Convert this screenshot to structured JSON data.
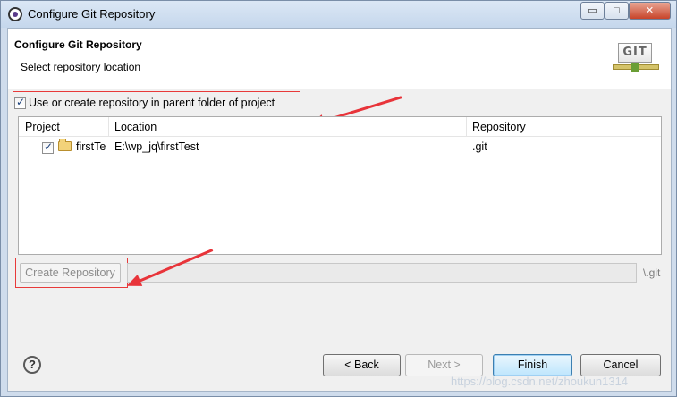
{
  "window": {
    "title": "Configure Git Repository",
    "min_glyph": "▭",
    "max_glyph": "□",
    "close_glyph": "✕"
  },
  "header": {
    "title": "Configure Git Repository",
    "subtitle": "Select repository location",
    "logo_text": "GIT"
  },
  "use_parent_checkbox": {
    "label": "Use or create repository in parent folder of project",
    "checked": true
  },
  "table": {
    "columns": [
      "Project",
      "Location",
      "Repository"
    ],
    "rows": [
      {
        "checked": true,
        "project": "firstTe",
        "location": "E:\\wp_jq\\firstTest",
        "repository": ".git"
      }
    ]
  },
  "create_repository": {
    "button_label": "Create Repository",
    "path_value": "",
    "path_suffix": "\\.git"
  },
  "footer": {
    "help_glyph": "?",
    "back_label": "< Back",
    "next_label": "Next >",
    "finish_label": "Finish",
    "cancel_label": "Cancel"
  },
  "watermark": "https://blog.csdn.net/zhoukun1314",
  "colors": {
    "annotation_red": "#e83a3a",
    "window_frame": "#cfdcec",
    "dialog_bg": "#f0f0f0"
  },
  "icons": [
    "app-icon",
    "git-logo-icon",
    "folder-icon",
    "help-icon",
    "arrow-annotation"
  ]
}
